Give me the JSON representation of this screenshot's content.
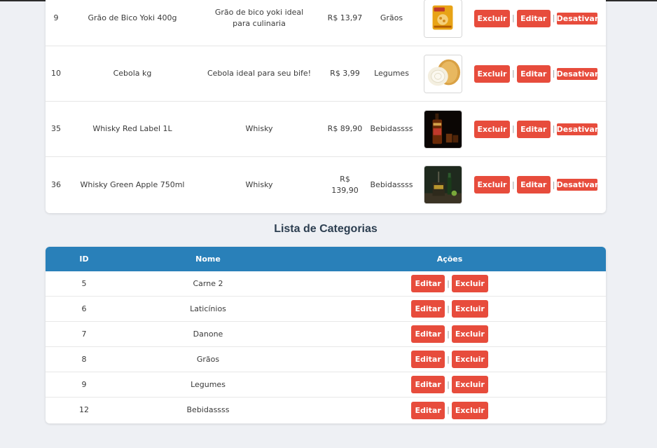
{
  "products": {
    "rows": [
      {
        "id": "9",
        "name": "Grão de Bico Yoki 400g",
        "description": "Grão de bico yoki ideal para culinaria",
        "price": "R$ 13,97",
        "category": "Grãos",
        "image_icon": "chickpea-package-image"
      },
      {
        "id": "10",
        "name": "Cebola kg",
        "description": "Cebola ideal para seu bife!",
        "price": "R$ 3,99",
        "category": "Legumes",
        "image_icon": "onion-image"
      },
      {
        "id": "35",
        "name": "Whisky Red Label 1L",
        "description": "Whisky",
        "price": "R$ 89,90",
        "category": "Bebidassss",
        "image_icon": "whisky-red-label-image"
      },
      {
        "id": "36",
        "name": "Whisky Green Apple 750ml",
        "description": "Whisky",
        "price": "R$ 139,90",
        "category": "Bebidassss",
        "image_icon": "whisky-green-apple-image"
      }
    ],
    "actions": {
      "delete_label": "Excluir",
      "edit_label": "Editar",
      "deactivate_label": "Desativar",
      "separator": "|"
    }
  },
  "categories": {
    "title": "Lista de Categorias",
    "columns": {
      "id": "ID",
      "name": "Nome",
      "actions": "Ações"
    },
    "rows": [
      {
        "id": "5",
        "name": "Carne 2"
      },
      {
        "id": "6",
        "name": "Laticínios"
      },
      {
        "id": "7",
        "name": "Danone"
      },
      {
        "id": "8",
        "name": "Grãos"
      },
      {
        "id": "9",
        "name": "Legumes"
      },
      {
        "id": "12",
        "name": "Bebidassss"
      }
    ],
    "actions": {
      "edit_label": "Editar",
      "delete_label": "Excluir",
      "separator": "|"
    }
  },
  "colors": {
    "danger": "#e74c3c",
    "header": "#2980b9",
    "title": "#2c3e50",
    "background": "#eef0f4"
  }
}
